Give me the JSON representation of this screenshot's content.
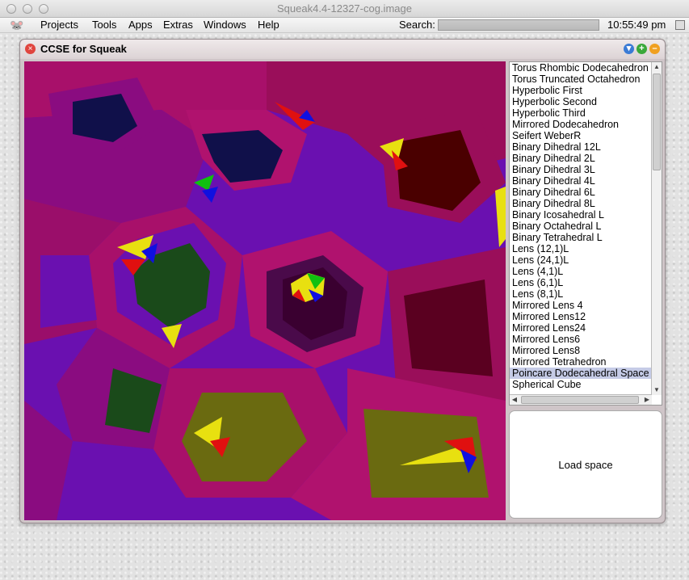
{
  "os": {
    "title": "Squeak4.4-12327-cog.image",
    "menus": [
      "Projects",
      "Tools",
      "Apps",
      "Extras",
      "Windows",
      "Help"
    ],
    "search_label": "Search:",
    "clock": "10:55:49 pm",
    "logo_icon": "squeak-mouse-icon"
  },
  "window": {
    "title": "CCSE for Squeak",
    "close_icon": "close-icon",
    "buttons": [
      "menu-down-icon",
      "expand-plus-icon",
      "collapse-icon"
    ]
  },
  "space_list": {
    "items": [
      "Torus Rhombic Dodecahedron",
      "Torus Truncated Octahedron",
      "Hyperbolic First",
      "Hyperbolic Second",
      "Hyperbolic Third",
      "Mirrored Dodecahedron",
      "Seifert WeberR",
      "Binary Dihedral 12L",
      "Binary Dihedral 2L",
      "Binary Dihedral 3L",
      "Binary Dihedral 4L",
      "Binary Dihedral 6L",
      "Binary Dihedral 8L",
      "Binary Icosahedral L",
      "Binary Octahedral L",
      "Binary Tetrahedral L",
      "Lens (12,1)L",
      "Lens (24,1)L",
      "Lens (4,1)L",
      "Lens (6,1)L",
      "Lens (8,1)L",
      "Mirrored Lens 4",
      "Mirrored Lens12",
      "Mirrored Lens24",
      "Mirrored Lens6",
      "Mirrored Lens8",
      "Mirrored Tetrahedron",
      "Poincare Dodecahedral Space",
      "Spherical Cube"
    ],
    "selected_index": 27
  },
  "load_button": {
    "label": "Load space"
  },
  "colors": {
    "magenta": "#a8106a",
    "purple": "#6a10b0",
    "selection": "#c5cbe6"
  }
}
